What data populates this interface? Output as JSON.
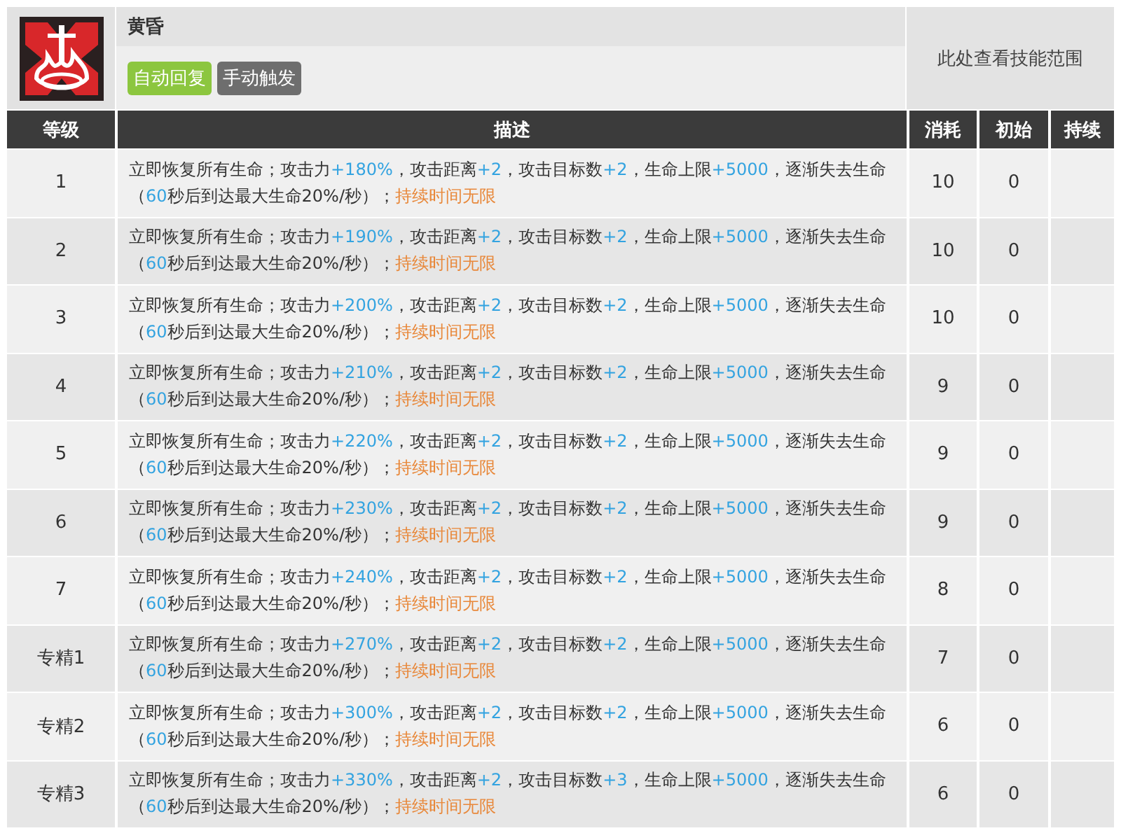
{
  "skill": {
    "name": "黄昏",
    "tags": [
      {
        "label": "自动回复",
        "color": "#8cc63f"
      },
      {
        "label": "手动触发",
        "color": "#6e6e6e"
      }
    ],
    "range_link": "此处查看技能范围"
  },
  "table": {
    "columns": [
      "等级",
      "描述",
      "消耗",
      "初始",
      "持续"
    ],
    "rows": [
      {
        "level": "1",
        "description": [
          {
            "kind": "plain",
            "text": "立即恢复所有生命；攻击力"
          },
          {
            "kind": "buff",
            "text": "+180%"
          },
          {
            "kind": "plain",
            "text": "，攻击距离"
          },
          {
            "kind": "buff",
            "text": "+2"
          },
          {
            "kind": "plain",
            "text": "，攻击目标数"
          },
          {
            "kind": "buff",
            "text": "+2"
          },
          {
            "kind": "plain",
            "text": "，生命上限"
          },
          {
            "kind": "buff",
            "text": "+5000"
          },
          {
            "kind": "plain",
            "text": "，逐渐失去生命（"
          },
          {
            "kind": "buff",
            "text": "60"
          },
          {
            "kind": "plain",
            "text": "秒后到达最大生命20%/秒）；"
          },
          {
            "kind": "duration",
            "text": "持续时间无限"
          }
        ],
        "cost": "10",
        "initial": "0"
      },
      {
        "level": "2",
        "description": [
          {
            "kind": "plain",
            "text": "立即恢复所有生命；攻击力"
          },
          {
            "kind": "buff",
            "text": "+190%"
          },
          {
            "kind": "plain",
            "text": "，攻击距离"
          },
          {
            "kind": "buff",
            "text": "+2"
          },
          {
            "kind": "plain",
            "text": "，攻击目标数"
          },
          {
            "kind": "buff",
            "text": "+2"
          },
          {
            "kind": "plain",
            "text": "，生命上限"
          },
          {
            "kind": "buff",
            "text": "+5000"
          },
          {
            "kind": "plain",
            "text": "，逐渐失去生命（"
          },
          {
            "kind": "buff",
            "text": "60"
          },
          {
            "kind": "plain",
            "text": "秒后到达最大生命20%/秒）；"
          },
          {
            "kind": "duration",
            "text": "持续时间无限"
          }
        ],
        "cost": "10",
        "initial": "0"
      },
      {
        "level": "3",
        "description": [
          {
            "kind": "plain",
            "text": "立即恢复所有生命；攻击力"
          },
          {
            "kind": "buff",
            "text": "+200%"
          },
          {
            "kind": "plain",
            "text": "，攻击距离"
          },
          {
            "kind": "buff",
            "text": "+2"
          },
          {
            "kind": "plain",
            "text": "，攻击目标数"
          },
          {
            "kind": "buff",
            "text": "+2"
          },
          {
            "kind": "plain",
            "text": "，生命上限"
          },
          {
            "kind": "buff",
            "text": "+5000"
          },
          {
            "kind": "plain",
            "text": "，逐渐失去生命（"
          },
          {
            "kind": "buff",
            "text": "60"
          },
          {
            "kind": "plain",
            "text": "秒后到达最大生命20%/秒）；"
          },
          {
            "kind": "duration",
            "text": "持续时间无限"
          }
        ],
        "cost": "10",
        "initial": "0"
      },
      {
        "level": "4",
        "description": [
          {
            "kind": "plain",
            "text": "立即恢复所有生命；攻击力"
          },
          {
            "kind": "buff",
            "text": "+210%"
          },
          {
            "kind": "plain",
            "text": "，攻击距离"
          },
          {
            "kind": "buff",
            "text": "+2"
          },
          {
            "kind": "plain",
            "text": "，攻击目标数"
          },
          {
            "kind": "buff",
            "text": "+2"
          },
          {
            "kind": "plain",
            "text": "，生命上限"
          },
          {
            "kind": "buff",
            "text": "+5000"
          },
          {
            "kind": "plain",
            "text": "，逐渐失去生命（"
          },
          {
            "kind": "buff",
            "text": "60"
          },
          {
            "kind": "plain",
            "text": "秒后到达最大生命20%/秒）；"
          },
          {
            "kind": "duration",
            "text": "持续时间无限"
          }
        ],
        "cost": "9",
        "initial": "0"
      },
      {
        "level": "5",
        "description": [
          {
            "kind": "plain",
            "text": "立即恢复所有生命；攻击力"
          },
          {
            "kind": "buff",
            "text": "+220%"
          },
          {
            "kind": "plain",
            "text": "，攻击距离"
          },
          {
            "kind": "buff",
            "text": "+2"
          },
          {
            "kind": "plain",
            "text": "，攻击目标数"
          },
          {
            "kind": "buff",
            "text": "+2"
          },
          {
            "kind": "plain",
            "text": "，生命上限"
          },
          {
            "kind": "buff",
            "text": "+5000"
          },
          {
            "kind": "plain",
            "text": "，逐渐失去生命（"
          },
          {
            "kind": "buff",
            "text": "60"
          },
          {
            "kind": "plain",
            "text": "秒后到达最大生命20%/秒）；"
          },
          {
            "kind": "duration",
            "text": "持续时间无限"
          }
        ],
        "cost": "9",
        "initial": "0"
      },
      {
        "level": "6",
        "description": [
          {
            "kind": "plain",
            "text": "立即恢复所有生命；攻击力"
          },
          {
            "kind": "buff",
            "text": "+230%"
          },
          {
            "kind": "plain",
            "text": "，攻击距离"
          },
          {
            "kind": "buff",
            "text": "+2"
          },
          {
            "kind": "plain",
            "text": "，攻击目标数"
          },
          {
            "kind": "buff",
            "text": "+2"
          },
          {
            "kind": "plain",
            "text": "，生命上限"
          },
          {
            "kind": "buff",
            "text": "+5000"
          },
          {
            "kind": "plain",
            "text": "，逐渐失去生命（"
          },
          {
            "kind": "buff",
            "text": "60"
          },
          {
            "kind": "plain",
            "text": "秒后到达最大生命20%/秒）；"
          },
          {
            "kind": "duration",
            "text": "持续时间无限"
          }
        ],
        "cost": "9",
        "initial": "0"
      },
      {
        "level": "7",
        "description": [
          {
            "kind": "plain",
            "text": "立即恢复所有生命；攻击力"
          },
          {
            "kind": "buff",
            "text": "+240%"
          },
          {
            "kind": "plain",
            "text": "，攻击距离"
          },
          {
            "kind": "buff",
            "text": "+2"
          },
          {
            "kind": "plain",
            "text": "，攻击目标数"
          },
          {
            "kind": "buff",
            "text": "+2"
          },
          {
            "kind": "plain",
            "text": "，生命上限"
          },
          {
            "kind": "buff",
            "text": "+5000"
          },
          {
            "kind": "plain",
            "text": "，逐渐失去生命（"
          },
          {
            "kind": "buff",
            "text": "60"
          },
          {
            "kind": "plain",
            "text": "秒后到达最大生命20%/秒）；"
          },
          {
            "kind": "duration",
            "text": "持续时间无限"
          }
        ],
        "cost": "8",
        "initial": "0"
      },
      {
        "level": "专精1",
        "description": [
          {
            "kind": "plain",
            "text": "立即恢复所有生命；攻击力"
          },
          {
            "kind": "buff",
            "text": "+270%"
          },
          {
            "kind": "plain",
            "text": "，攻击距离"
          },
          {
            "kind": "buff",
            "text": "+2"
          },
          {
            "kind": "plain",
            "text": "，攻击目标数"
          },
          {
            "kind": "buff",
            "text": "+2"
          },
          {
            "kind": "plain",
            "text": "，生命上限"
          },
          {
            "kind": "buff",
            "text": "+5000"
          },
          {
            "kind": "plain",
            "text": "，逐渐失去生命（"
          },
          {
            "kind": "buff",
            "text": "60"
          },
          {
            "kind": "plain",
            "text": "秒后到达最大生命20%/秒）；"
          },
          {
            "kind": "duration",
            "text": "持续时间无限"
          }
        ],
        "cost": "7",
        "initial": "0"
      },
      {
        "level": "专精2",
        "description": [
          {
            "kind": "plain",
            "text": "立即恢复所有生命；攻击力"
          },
          {
            "kind": "buff",
            "text": "+300%"
          },
          {
            "kind": "plain",
            "text": "，攻击距离"
          },
          {
            "kind": "buff",
            "text": "+2"
          },
          {
            "kind": "plain",
            "text": "，攻击目标数"
          },
          {
            "kind": "buff",
            "text": "+2"
          },
          {
            "kind": "plain",
            "text": "，生命上限"
          },
          {
            "kind": "buff",
            "text": "+5000"
          },
          {
            "kind": "plain",
            "text": "，逐渐失去生命（"
          },
          {
            "kind": "buff",
            "text": "60"
          },
          {
            "kind": "plain",
            "text": "秒后到达最大生命20%/秒）；"
          },
          {
            "kind": "duration",
            "text": "持续时间无限"
          }
        ],
        "cost": "6",
        "initial": "0"
      },
      {
        "level": "专精3",
        "description": [
          {
            "kind": "plain",
            "text": "立即恢复所有生命；攻击力"
          },
          {
            "kind": "buff",
            "text": "+330%"
          },
          {
            "kind": "plain",
            "text": "，攻击距离"
          },
          {
            "kind": "buff",
            "text": "+2"
          },
          {
            "kind": "plain",
            "text": "，攻击目标数"
          },
          {
            "kind": "buff",
            "text": "+3"
          },
          {
            "kind": "plain",
            "text": "，生命上限"
          },
          {
            "kind": "buff",
            "text": "+5000"
          },
          {
            "kind": "plain",
            "text": "，逐渐失去生命（"
          },
          {
            "kind": "buff",
            "text": "60"
          },
          {
            "kind": "plain",
            "text": "秒后到达最大生命20%/秒）；"
          },
          {
            "kind": "duration",
            "text": "持续时间无限"
          }
        ],
        "cost": "6",
        "initial": "0"
      }
    ]
  }
}
